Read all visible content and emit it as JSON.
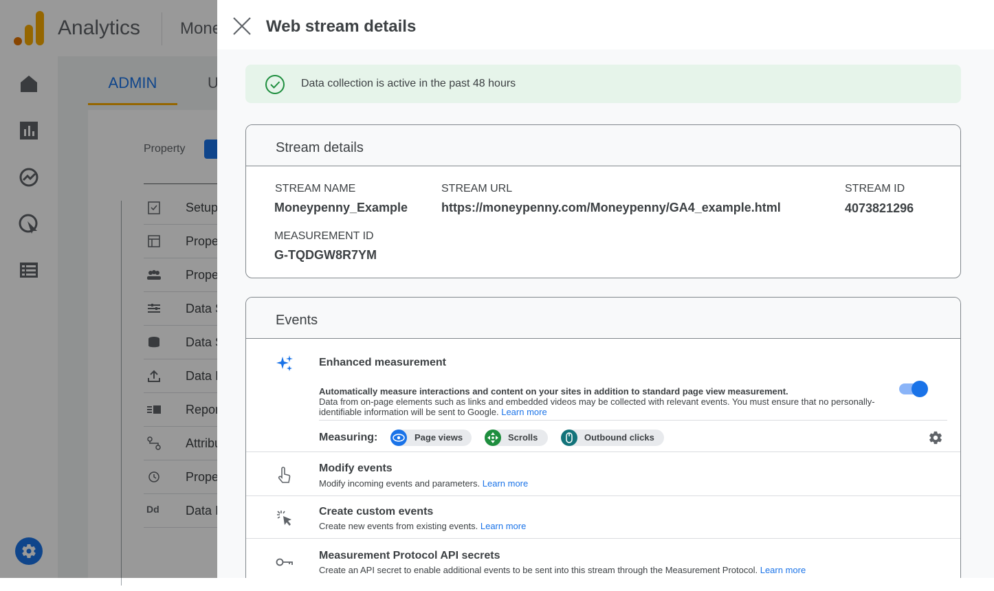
{
  "app": {
    "title": "Analytics",
    "account": "Mone",
    "tabs": {
      "admin": "ADMIN",
      "user": "U"
    },
    "property_label": "Property",
    "menu": [
      {
        "label": "Setup",
        "icon": "checklist-icon"
      },
      {
        "label": "Prope",
        "icon": "property-details-icon"
      },
      {
        "label": "Prope",
        "icon": "people-icon"
      },
      {
        "label": "Data S",
        "icon": "data-streams-icon"
      },
      {
        "label": "Data S",
        "icon": "database-icon"
      },
      {
        "label": "Data I",
        "icon": "upload-icon"
      },
      {
        "label": "Repor",
        "icon": "report-identity-icon"
      },
      {
        "label": "Attribu",
        "icon": "attribution-icon"
      },
      {
        "label": "Prope",
        "icon": "history-icon"
      },
      {
        "label": "Data I",
        "icon": "dd-icon",
        "glyph": "Dd"
      }
    ]
  },
  "panel": {
    "title": "Web stream details",
    "banner": "Data collection is active in the past 48 hours",
    "stream_details": {
      "title": "Stream details",
      "stream_name_label": "STREAM NAME",
      "stream_name": "Moneypenny_Example",
      "stream_url_label": "STREAM URL",
      "stream_url": "https://moneypenny.com/Moneypenny/GA4_example.html",
      "stream_id_label": "STREAM ID",
      "stream_id": "4073821296",
      "measurement_id_label": "MEASUREMENT ID",
      "measurement_id": "G-TQDGW8R7YM"
    },
    "events": {
      "title": "Events",
      "enhanced": {
        "title": "Enhanced measurement",
        "bold": "Automatically measure interactions and content on your sites in addition to standard page view measurement.",
        "desc": "Data from on-page elements such as links and embedded videos may be collected with relevant events. You must ensure that no personally-identifiable information will be sent to Google.",
        "learn_more": "Learn more",
        "toggle_on": true,
        "measuring_label": "Measuring:",
        "chips": [
          "Page views",
          "Scrolls",
          "Outbound clicks"
        ]
      },
      "modify": {
        "title": "Modify events",
        "desc": "Modify incoming events and parameters.",
        "learn_more": "Learn more"
      },
      "custom": {
        "title": "Create custom events",
        "desc": "Create new events from existing events.",
        "learn_more": "Learn more"
      },
      "mp": {
        "title": "Measurement Protocol API secrets",
        "desc": "Create an API secret to enable additional events to be sent into this stream through the Measurement Protocol.",
        "learn_more": "Learn more"
      }
    }
  },
  "colors": {
    "accent": "#1a73e8",
    "success_bg": "#e6f4ea",
    "success": "#1e8e3e",
    "logo_orange": "#f9ab00",
    "logo_dark": "#e37400"
  }
}
